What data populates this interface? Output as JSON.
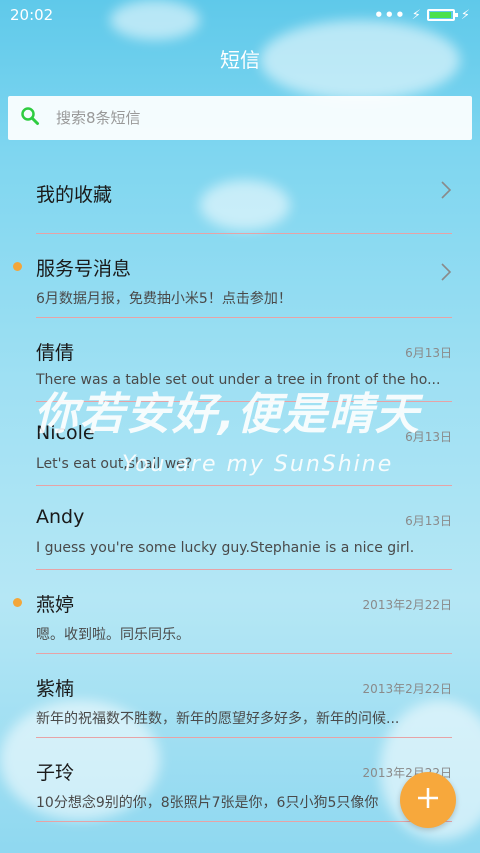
{
  "status_bar": {
    "time": "20:02",
    "signal_dots": "•••",
    "bolt_left": "⚡",
    "bolt_right": "⚡"
  },
  "title": "短信",
  "search": {
    "placeholder": "搜索8条短信"
  },
  "conversations": [
    {
      "name": "我的收藏",
      "snippet": "",
      "date": "",
      "unread": false,
      "has_chevron": true
    },
    {
      "name": "服务号消息",
      "snippet": "6月数据月报，免费抽小米5！点击参加！",
      "date": "",
      "unread": true,
      "has_chevron": true
    },
    {
      "name": "倩倩",
      "snippet": "There was a table set out under a tree in front of the ho...",
      "date": "6月13日",
      "unread": false,
      "has_chevron": false
    },
    {
      "name": "Nicole",
      "snippet": "Let's eat out,shall we?",
      "date": "6月13日",
      "unread": false,
      "has_chevron": false
    },
    {
      "name": "Andy",
      "snippet": "I guess you're some lucky guy.Stephanie is a nice girl.",
      "date": "6月13日",
      "unread": false,
      "has_chevron": false
    },
    {
      "name": "燕婷",
      "snippet": "嗯。收到啦。同乐同乐。",
      "date": "2013年2月22日",
      "unread": true,
      "has_chevron": false
    },
    {
      "name": "紫楠",
      "snippet": "新年的祝福数不胜数，新年的愿望好多好多，新年的问候...",
      "date": "2013年2月22日",
      "unread": false,
      "has_chevron": false
    },
    {
      "name": "子玲",
      "snippet": "10分想念9别的你，8张照片7张是你，6只小狗5只像你",
      "date": "2013年2月22日",
      "unread": false,
      "has_chevron": false
    }
  ],
  "wallpaper_text": {
    "line1": "你若安好,便是晴天",
    "line2": "You are my SunShine"
  },
  "colors": {
    "accent": "#f7a83c",
    "unread_dot": "#f3a63a",
    "divider": "#e7a3a6",
    "search_icon": "#2ecc40"
  },
  "fab": {
    "icon": "plus-icon"
  }
}
